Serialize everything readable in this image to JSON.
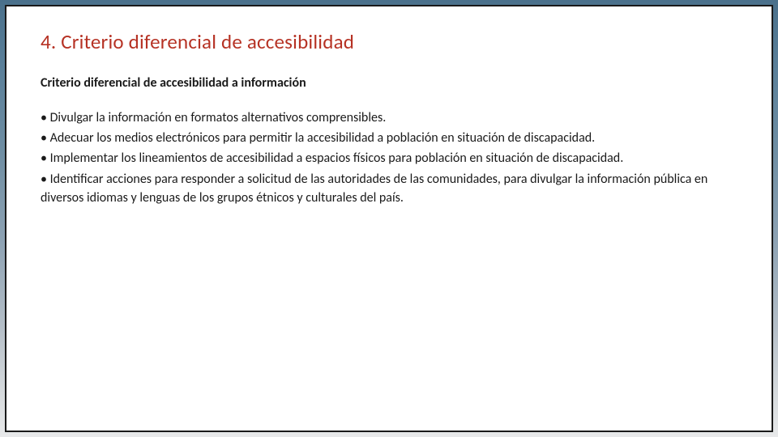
{
  "slide": {
    "title": "4. Criterio diferencial de accesibilidad",
    "subtitle": "Criterio diferencial de accesibilidad a información",
    "bullets": [
      "• Divulgar la información en formatos alternativos comprensibles.",
      "• Adecuar los medios electrónicos para permitir la accesibilidad a población en situación de discapacidad.",
      "• Implementar los lineamientos de accesibilidad a espacios físicos para población en situación de discapacidad.",
      "• Identificar acciones para responder a solicitud de las autoridades de las comunidades, para divulgar la información pública en diversos idiomas y lenguas de los grupos étnicos y culturales del país."
    ]
  }
}
